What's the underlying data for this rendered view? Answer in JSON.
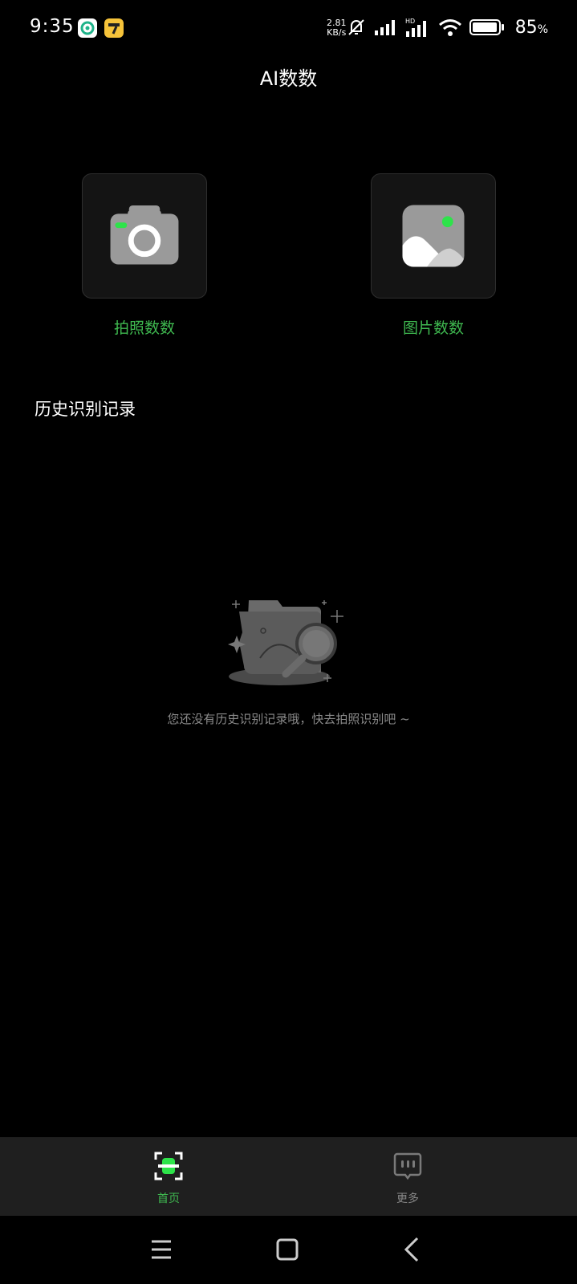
{
  "status_bar": {
    "time": "9:35",
    "net_speed_value": "2.81",
    "net_speed_unit": "KB/s",
    "battery_value": "85",
    "battery_unit": "%",
    "icons": [
      "app-icon-1",
      "app-icon-2",
      "mute-icon",
      "signal-icon",
      "hd-signal-icon",
      "wifi-icon",
      "battery-icon"
    ]
  },
  "header": {
    "title": "AI数数"
  },
  "actions": [
    {
      "label": "拍照数数",
      "icon": "camera-icon"
    },
    {
      "label": "图片数数",
      "icon": "image-icon"
    }
  ],
  "history": {
    "title": "历史识别记录",
    "empty_text": "您还没有历史识别记录哦，快去拍照识别吧 ~"
  },
  "bottom_nav": {
    "items": [
      {
        "label": "首页",
        "icon": "scan-icon",
        "active": true
      },
      {
        "label": "更多",
        "icon": "more-icon",
        "active": false
      }
    ]
  },
  "colors": {
    "accent": "#3fb950",
    "background": "#000000",
    "nav_background": "#1f1f1f"
  }
}
